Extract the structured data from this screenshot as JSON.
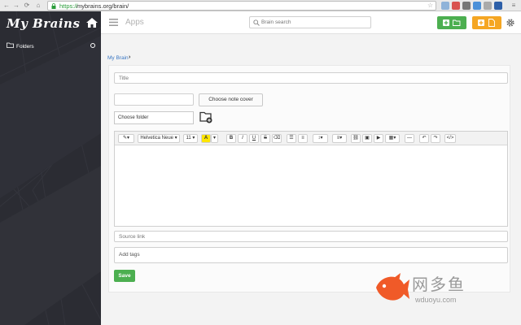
{
  "browser": {
    "url_scheme": "https://",
    "url_rest": "mybrains.org/brain/"
  },
  "sidebar": {
    "logo": "My Brains",
    "folders_label": "Folders"
  },
  "topbar": {
    "apps_label": "Apps",
    "search_placeholder": "Brain search"
  },
  "breadcrumb": {
    "item": "My Brain",
    "separator": "›"
  },
  "form": {
    "title_placeholder": "Title",
    "cover_button": "Choose note cover",
    "folder_select": "Choose folder",
    "source_link_placeholder": "Source link",
    "tags_placeholder": "Add tags",
    "save_button": "Save"
  },
  "editor_toolbar": {
    "font_name": "Helvetica Neue",
    "font_size": "11",
    "color_letter": "A",
    "bold": "B",
    "italic": "I",
    "underline": "U",
    "strike": "S"
  },
  "watermark": {
    "chinese": "网多鱼",
    "url": "wduoyu.com"
  },
  "colors": {
    "sidebar_bg": "#2b2c33",
    "success_green": "#4caf50",
    "accent_orange": "#f5a623",
    "link_blue": "#3b78c4"
  }
}
